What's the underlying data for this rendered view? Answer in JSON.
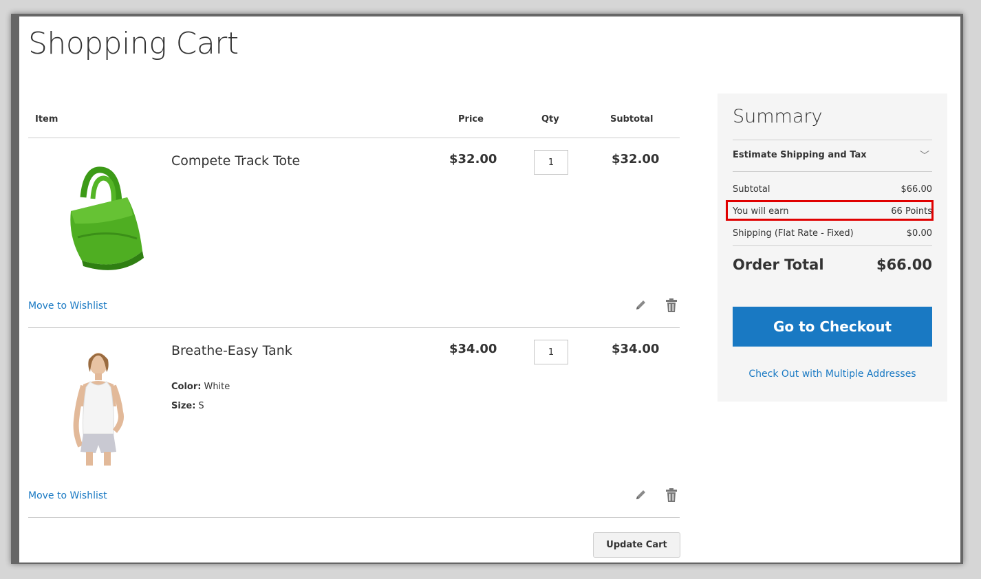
{
  "page": {
    "title": "Shopping Cart"
  },
  "cart": {
    "headers": {
      "item": "Item",
      "price": "Price",
      "qty": "Qty",
      "subtotal": "Subtotal"
    },
    "items": [
      {
        "name": "Compete Track Tote",
        "price": "$32.00",
        "qty": "1",
        "subtotal": "$32.00",
        "image": "green-tote-bag",
        "wishlist": "Move to Wishlist"
      },
      {
        "name": "Breathe-Easy Tank",
        "price": "$34.00",
        "qty": "1",
        "subtotal": "$34.00",
        "image": "woman-white-tank-top",
        "options": [
          {
            "label": "Color:",
            "value": "White"
          },
          {
            "label": "Size:",
            "value": "S"
          }
        ],
        "wishlist": "Move to Wishlist"
      }
    ],
    "update_label": "Update Cart"
  },
  "summary": {
    "title": "Summary",
    "estimate": "Estimate Shipping and Tax",
    "subtotal_label": "Subtotal",
    "subtotal_value": "$66.00",
    "earn_label": "You will earn",
    "earn_value": "66 Points",
    "shipping_label": "Shipping (Flat Rate - Fixed)",
    "shipping_value": "$0.00",
    "order_total_label": "Order Total",
    "order_total_value": "$66.00",
    "checkout_label": "Go to Checkout",
    "multi_label": "Check Out with Multiple Addresses"
  },
  "colors": {
    "link": "#1979c3",
    "checkout_bg": "#1979c3",
    "highlight": "#e00000",
    "summary_bg": "#f5f5f5"
  }
}
